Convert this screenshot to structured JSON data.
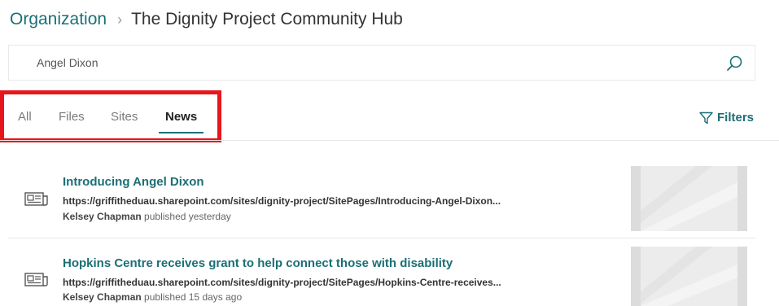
{
  "breadcrumb": {
    "parent": "Organization",
    "separator": "›",
    "current": "The Dignity Project Community Hub"
  },
  "search": {
    "value": "Angel Dixon"
  },
  "tabs": [
    {
      "label": "All",
      "active": false
    },
    {
      "label": "Files",
      "active": false
    },
    {
      "label": "Sites",
      "active": false
    },
    {
      "label": "News",
      "active": true
    }
  ],
  "filters": {
    "label": "Filters"
  },
  "results": [
    {
      "title": "Introducing Angel Dixon",
      "url": "https://griffitheduau.sharepoint.com/sites/dignity-project/SitePages/Introducing-Angel-Dixon...",
      "author": "Kelsey Chapman",
      "published": "published yesterday"
    },
    {
      "title": "Hopkins Centre receives grant to help connect those with disability",
      "url": "https://griffitheduau.sharepoint.com/sites/dignity-project/SitePages/Hopkins-Centre-receives...",
      "author": "Kelsey Chapman",
      "published": "published 15 days ago"
    }
  ],
  "colors": {
    "accent": "#1b6f75",
    "highlight": "#e8161b"
  }
}
